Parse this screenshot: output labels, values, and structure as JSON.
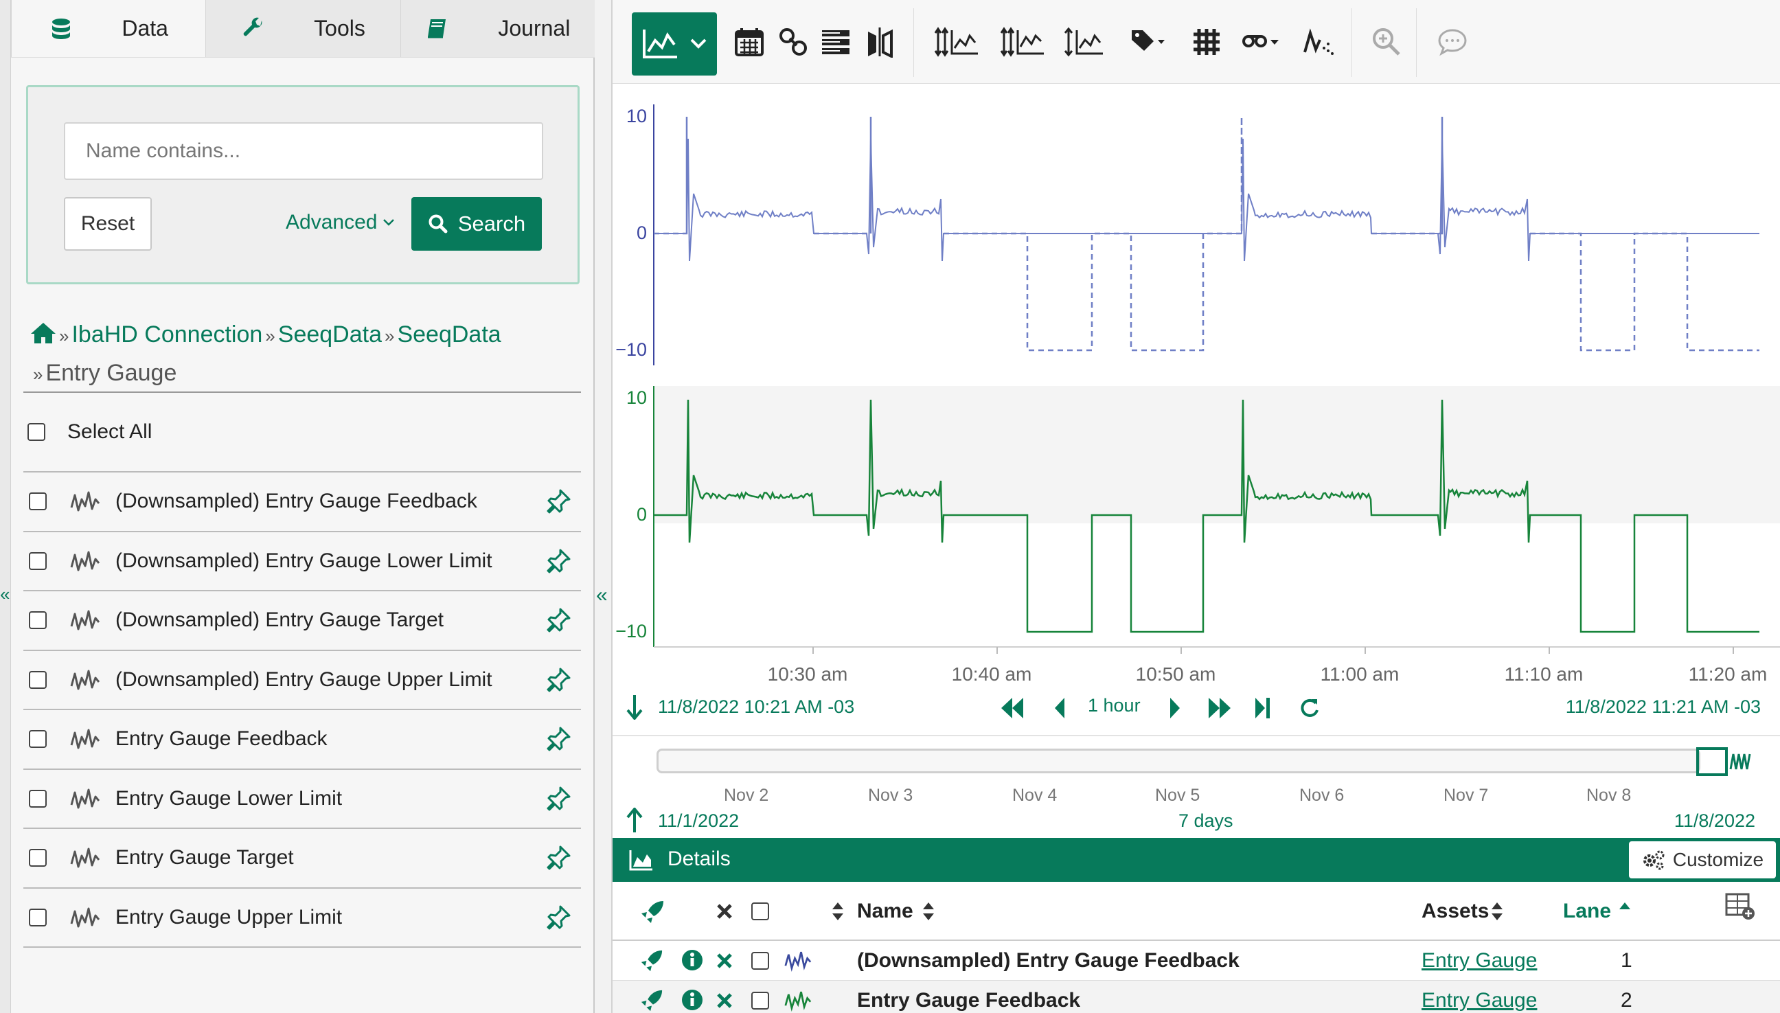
{
  "tabs": [
    {
      "label": "Data",
      "icon": "database-icon"
    },
    {
      "label": "Tools",
      "icon": "wrench-icon"
    },
    {
      "label": "Journal",
      "icon": "book-icon"
    }
  ],
  "search": {
    "placeholder": "Name contains...",
    "reset_label": "Reset",
    "advanced_label": "Advanced",
    "search_label": "Search"
  },
  "breadcrumb": {
    "items": [
      "IbaHD Connection",
      "SeeqData",
      "SeeqData"
    ],
    "current": "Entry Gauge",
    "separator": "»"
  },
  "select_all_label": "Select All",
  "items": [
    "(Downsampled) Entry Gauge Feedback",
    "(Downsampled) Entry Gauge Lower Limit",
    "(Downsampled) Entry Gauge Target",
    "(Downsampled) Entry Gauge Upper Limit",
    "Entry Gauge Feedback",
    "Entry Gauge Lower Limit",
    "Entry Gauge Target",
    "Entry Gauge Upper Limit"
  ],
  "toolbar": {
    "icons": [
      "trend-view-icon",
      "calendar-icon",
      "link-icon",
      "table-icon",
      "compare-icon",
      "lane-axis-icon",
      "shared-axis-icon",
      "autoscale-icon",
      "label-icon",
      "grid-icon",
      "custom-labels-icon",
      "dimming-icon",
      "zoom-icon",
      "comment-icon"
    ]
  },
  "chart_data": {
    "type": "line",
    "time_axis_labels": [
      "10:30 am",
      "10:40 am",
      "10:50 am",
      "11:00 am",
      "11:10 am",
      "11:20 am"
    ],
    "lanes": [
      {
        "ytick_labels": [
          "10",
          "0",
          "−10"
        ],
        "ylim": [
          -10,
          10
        ],
        "color": "#6f7fc6",
        "style": "solid+dashed"
      },
      {
        "ytick_labels": [
          "10",
          "0",
          "−10"
        ],
        "ylim": [
          -10,
          10
        ],
        "color": "#17843a",
        "style": "solid"
      }
    ],
    "grid": false,
    "legend": "none"
  },
  "display_range": {
    "start": "11/8/2022 10:21 AM  -03",
    "end": "11/8/2022 11:21 AM  -03",
    "duration": "1 hour"
  },
  "investigate_range": {
    "start": "11/1/2022",
    "end": "11/8/2022",
    "duration": "7 days",
    "ticks": [
      "Nov 2",
      "Nov 3",
      "Nov 4",
      "Nov 5",
      "Nov 6",
      "Nov 7",
      "Nov 8"
    ]
  },
  "details": {
    "title": "Details",
    "customize_label": "Customize",
    "columns": {
      "name": "Name",
      "assets": "Assets",
      "lane": "Lane"
    },
    "rows": [
      {
        "name": "(Downsampled) Entry Gauge Feedback",
        "asset": "Entry Gauge",
        "lane": "1",
        "color": "#3a4a9e"
      },
      {
        "name": "Entry Gauge Feedback",
        "asset": "Entry Gauge",
        "lane": "2",
        "color": "#17843a"
      }
    ]
  },
  "colors": {
    "accent": "#077a5b",
    "series1": "#6f7fc6",
    "series2": "#17843a"
  }
}
